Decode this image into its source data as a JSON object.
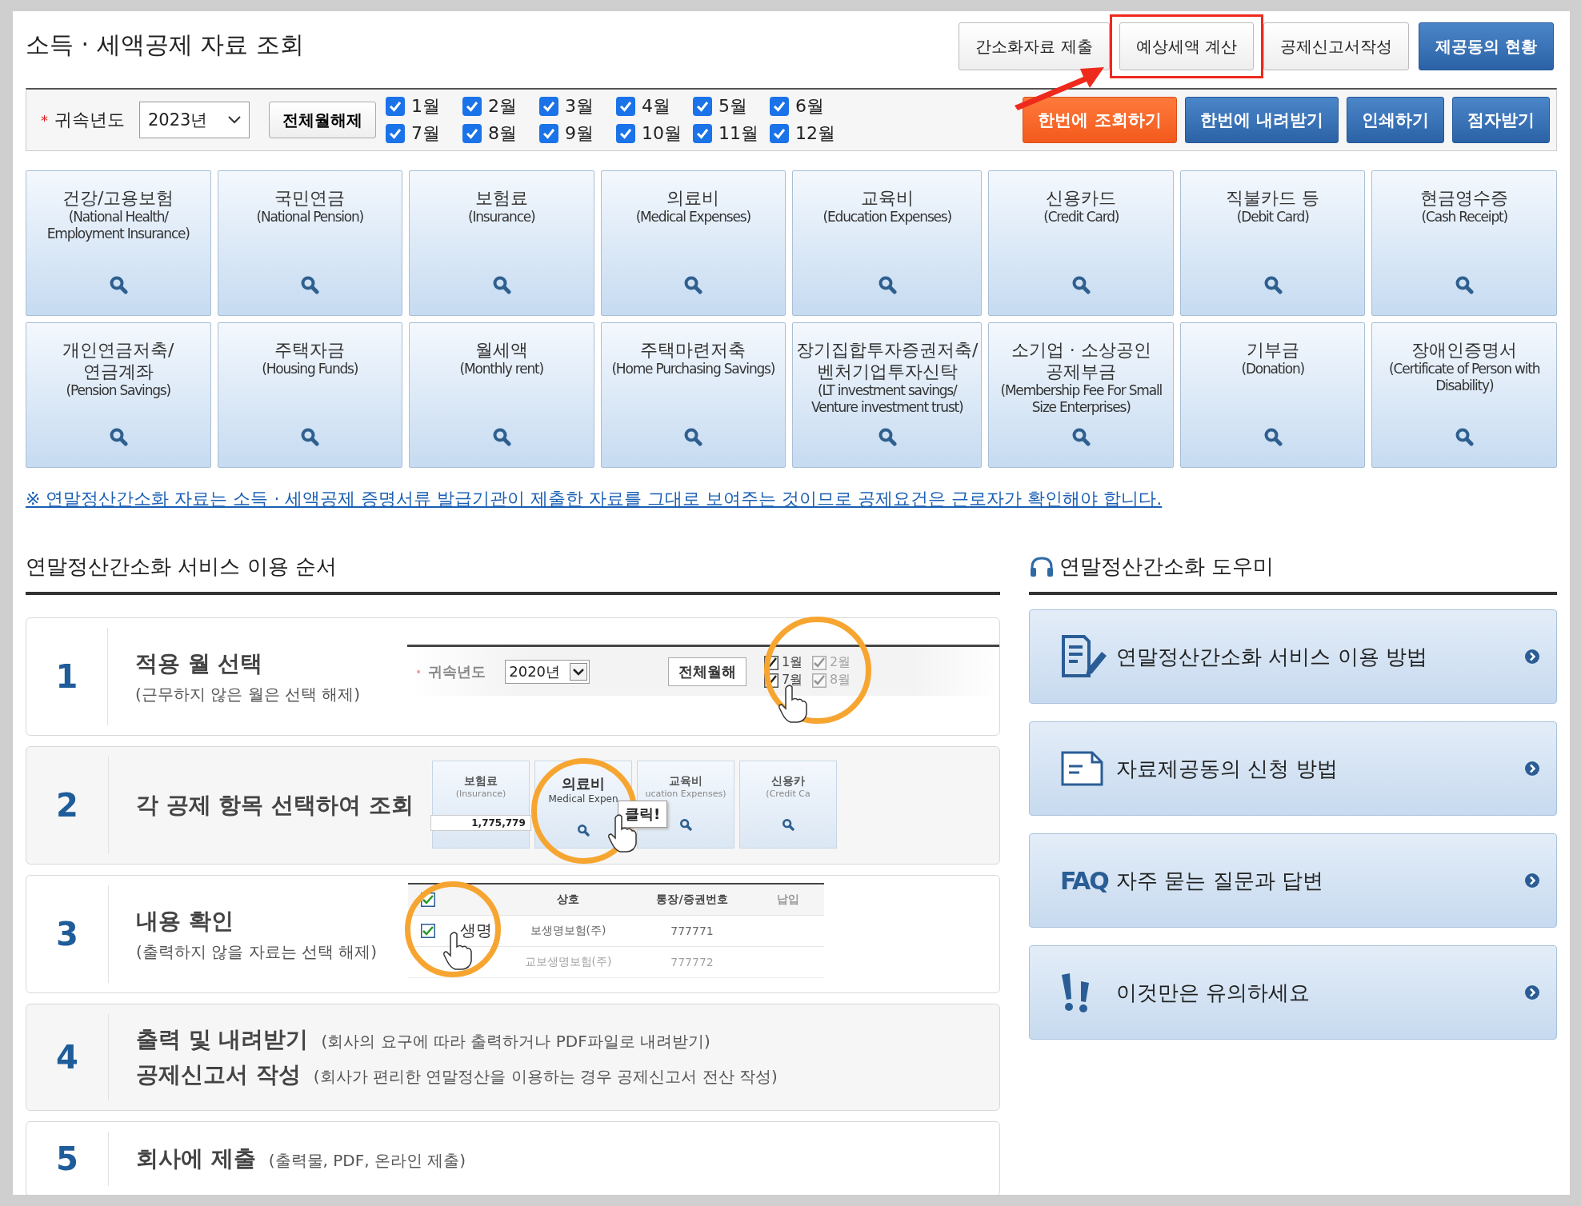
{
  "title": "소득 · 세액공제 자료 조회",
  "top_buttons": [
    {
      "label": "간소화자료 제출",
      "kind": "plain",
      "highlighted": false
    },
    {
      "label": "예상세액 계산",
      "kind": "plain",
      "highlighted": true
    },
    {
      "label": "공제신고서작성",
      "kind": "plain",
      "highlighted": false
    },
    {
      "label": "제공동의 현황",
      "kind": "primary",
      "highlighted": false
    }
  ],
  "filter": {
    "required_mark": "*",
    "year_label": "귀속년도",
    "year": "2023년",
    "clear_button": "전체월해제",
    "months": [
      {
        "label": "1월",
        "checked": true
      },
      {
        "label": "2월",
        "checked": true
      },
      {
        "label": "3월",
        "checked": true
      },
      {
        "label": "4월",
        "checked": true
      },
      {
        "label": "5월",
        "checked": true
      },
      {
        "label": "6월",
        "checked": true
      },
      {
        "label": "7월",
        "checked": true
      },
      {
        "label": "8월",
        "checked": true
      },
      {
        "label": "9월",
        "checked": true
      },
      {
        "label": "10월",
        "checked": true
      },
      {
        "label": "11월",
        "checked": true
      },
      {
        "label": "12월",
        "checked": true
      }
    ],
    "actions": [
      {
        "label": "한번에 조회하기",
        "kind": "orange"
      },
      {
        "label": "한번에 내려받기",
        "kind": "blue"
      },
      {
        "label": "인쇄하기",
        "kind": "blue"
      },
      {
        "label": "점자받기",
        "kind": "blue"
      }
    ]
  },
  "categories": [
    {
      "name_lines": [
        "건강/고용보험"
      ],
      "english": "(National Health/ Employment Insurance)"
    },
    {
      "name_lines": [
        "국민연금"
      ],
      "english": "(National Pension)"
    },
    {
      "name_lines": [
        "보험료"
      ],
      "english": "(Insurance)"
    },
    {
      "name_lines": [
        "의료비"
      ],
      "english": "(Medical Expenses)"
    },
    {
      "name_lines": [
        "교육비"
      ],
      "english": "(Education Expenses)"
    },
    {
      "name_lines": [
        "신용카드"
      ],
      "english": "(Credit Card)"
    },
    {
      "name_lines": [
        "직불카드 등"
      ],
      "english": "(Debit Card)"
    },
    {
      "name_lines": [
        "현금영수증"
      ],
      "english": "(Cash Receipt)"
    },
    {
      "name_lines": [
        "개인연금저축/",
        "연금계좌"
      ],
      "english": "(Pension Savings)"
    },
    {
      "name_lines": [
        "주택자금"
      ],
      "english": "(Housing Funds)"
    },
    {
      "name_lines": [
        "월세액"
      ],
      "english": "(Monthly rent)"
    },
    {
      "name_lines": [
        "주택마련저축"
      ],
      "english": "(Home Purchasing Savings)"
    },
    {
      "name_lines": [
        "장기집합투자증권저축/",
        "벤처기업투자신탁"
      ],
      "english": "(LT investment savings/ Venture investment trust)"
    },
    {
      "name_lines": [
        "소기업 · 소상공인",
        "공제부금"
      ],
      "english": "(Membership Fee For Small Size Enterprises)"
    },
    {
      "name_lines": [
        "기부금"
      ],
      "english": "(Donation)"
    },
    {
      "name_lines": [
        "장애인증명서"
      ],
      "english": "(Certificate of Person with Disability)"
    }
  ],
  "notice": "※ 연말정산간소화 자료는 소득 · 세액공제 증명서류 발급기관이 제출한 자료를 그대로 보여주는 것이므로 공제요건은 근로자가 확인해야 합니다.",
  "steps_section": {
    "title": "연말정산간소화 서비스 이용 순서",
    "steps": [
      {
        "number": "1",
        "lines": [
          {
            "title": "적용 월 선택",
            "desc": "(근무하지 않은 월은 선택 해제)"
          }
        ],
        "illustration": {
          "kind": "months",
          "required_mark": "•",
          "year_label": "귀속년도",
          "year": "2020년",
          "button": "전체월해",
          "months": [
            {
              "label": "1월",
              "checked": true
            },
            {
              "label": "7월",
              "checked": true
            },
            {
              "label": "2월",
              "checked": true
            },
            {
              "label": "8월",
              "checked": true
            }
          ]
        }
      },
      {
        "number": "2",
        "lines": [
          {
            "title": "각 공제 항목 선택하여 조회"
          }
        ],
        "illustration": {
          "kind": "tiles",
          "callout": "클릭!",
          "tiles": [
            {
              "name": "보험료",
              "english": "(Insurance)",
              "amount": "1,775,779",
              "selected": false
            },
            {
              "name": "의료비",
              "english": "Medical Expen",
              "selected": true
            },
            {
              "name": "교육비",
              "english": "ucation Expenses)",
              "selected": false
            },
            {
              "name": "신용카",
              "english": "(Credit Ca",
              "selected": false
            }
          ]
        }
      },
      {
        "number": "3",
        "lines": [
          {
            "title": "내용 확인",
            "desc": "(출력하지 않을 자료는 선택 해제)"
          }
        ],
        "illustration": {
          "kind": "table",
          "header_checked": true,
          "columns": [
            "상호",
            "통장/증권번호",
            "납입"
          ],
          "zoom_text": "생명",
          "rows": [
            {
              "checked": true,
              "cells": [
                "보생명보험(주)",
                "777771"
              ]
            },
            {
              "cells": [
                "교보생명보험(주)",
                "777772"
              ]
            }
          ]
        }
      },
      {
        "number": "4",
        "lines": [
          {
            "title": "출력 및 내려받기",
            "desc": "(회사의 요구에 따라 출력하거나 PDF파일로 내려받기)"
          },
          {
            "title": "공제신고서 작성",
            "desc": "(회사가 편리한 연말정산을 이용하는 경우 공제신고서 전산 작성)"
          }
        ]
      },
      {
        "number": "5",
        "lines": [
          {
            "title": "회사에 제출",
            "desc": "(출력물, PDF, 온라인 제출)"
          }
        ]
      }
    ]
  },
  "helper": {
    "title": "연말정산간소화 도우미",
    "items": [
      {
        "label": "연말정산간소화 서비스 이용 방법",
        "kind": "pen"
      },
      {
        "label": "자료제공동의 신청 방법",
        "kind": "form"
      },
      {
        "label": "자주 묻는 질문과 답변",
        "kind": "faq",
        "icon_text": "FAQ"
      },
      {
        "label": "이것만은 유의하세요",
        "kind": "notice"
      }
    ]
  }
}
